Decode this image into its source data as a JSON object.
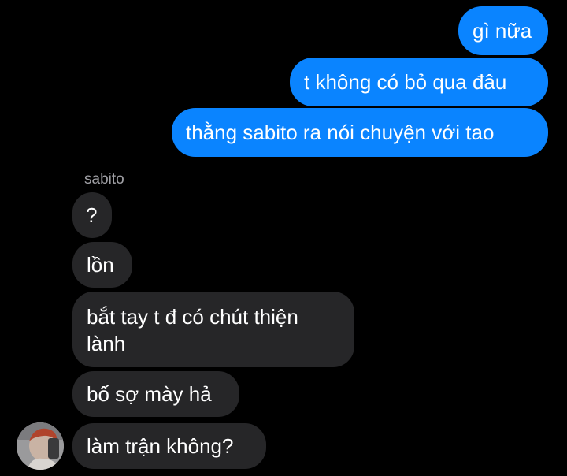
{
  "conversation": {
    "sent_messages": [
      {
        "text": "gì nữa"
      },
      {
        "text": "t không có bỏ qua đâu"
      },
      {
        "text": "thằng sabito ra nói chuyện với tao"
      }
    ],
    "received": {
      "sender_name": "sabito",
      "messages": [
        {
          "text": "?"
        },
        {
          "text": "lồn"
        },
        {
          "text": "bắt tay t đ có chút thiện lành"
        },
        {
          "text": "bố sợ mày hả"
        },
        {
          "text": "làm trận không?"
        }
      ]
    }
  },
  "colors": {
    "background": "#000000",
    "sent_bubble": "#0a84ff",
    "received_bubble": "#262628",
    "sender_name": "#a0a0a5"
  },
  "icons": {
    "avatar": "sender-avatar-photo"
  }
}
